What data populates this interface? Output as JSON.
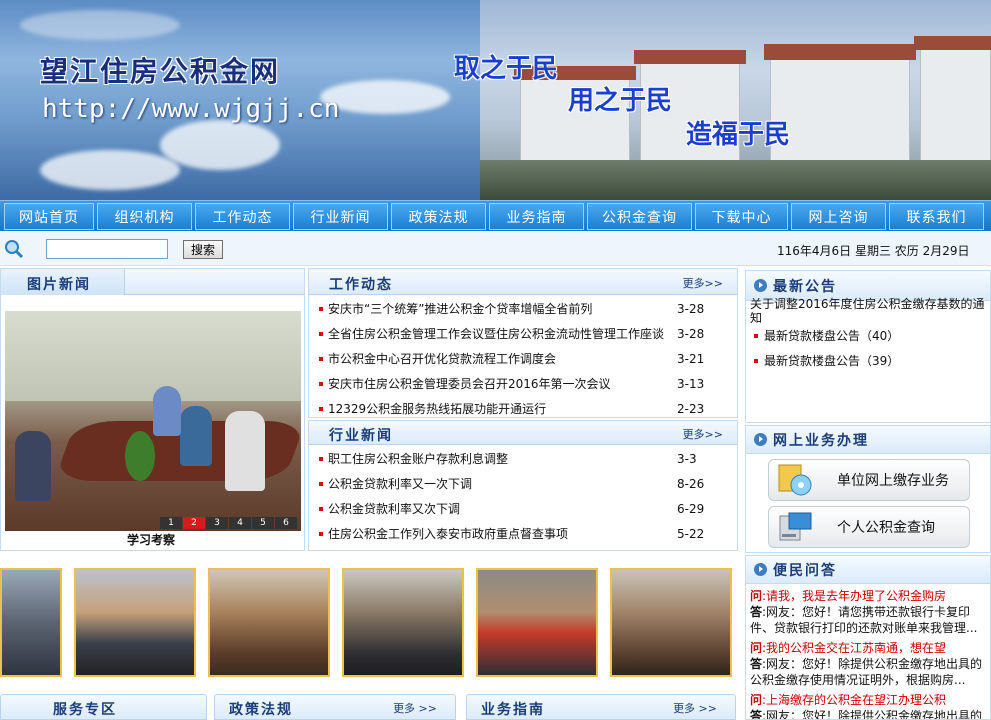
{
  "header": {
    "site_title": "望江住房公积金网",
    "site_url": "http://www.wjgjj.cn",
    "slogans": [
      "取之于民",
      "用之于民",
      "造福于民"
    ]
  },
  "nav": {
    "items": [
      "网站首页",
      "组织机构",
      "工作动态",
      "行业新闻",
      "政策法规",
      "业务指南",
      "公积金查询",
      "下载中心",
      "网上咨询",
      "联系我们"
    ]
  },
  "search": {
    "placeholder": "",
    "button_label": "搜索",
    "date_text": "116年4月6日 星期三 农历 2月29日"
  },
  "photo_news": {
    "tab_label": "图片新闻",
    "pages": [
      "1",
      "2",
      "3",
      "4",
      "5",
      "6"
    ],
    "active_page": "2",
    "caption": "学习考察"
  },
  "work_news": {
    "title": "工作动态",
    "more": "更多>>",
    "items": [
      {
        "title": "安庆市“三个统筹”推进公积金个贷率增幅全省前列",
        "date": "3-28"
      },
      {
        "title": "全省住房公积金管理工作会议暨住房公积金流动性管理工作座谈",
        "date": "3-28"
      },
      {
        "title": "市公积金中心召开优化贷款流程工作调度会",
        "date": "3-21"
      },
      {
        "title": "安庆市住房公积金管理委员会召开2016年第一次会议",
        "date": "3-13"
      },
      {
        "title": "12329公积金服务热线拓展功能开通运行",
        "date": "2-23"
      }
    ]
  },
  "industry_news": {
    "title": "行业新闻",
    "more": "更多>>",
    "items": [
      {
        "title": "职工住房公积金账户存款利息调整",
        "date": "3-3"
      },
      {
        "title": "公积金贷款利率又一次下调",
        "date": "8-26"
      },
      {
        "title": "公积金贷款利率又次下调",
        "date": "6-29"
      },
      {
        "title": "住房公积金工作列入泰安市政府重点督查事项",
        "date": "5-22"
      }
    ]
  },
  "announcements": {
    "title": "最新公告",
    "partial_text": "关于调整2016年度住房公积金缴存基数的通知",
    "items": [
      "最新贷款楼盘公告（40）",
      "最新贷款楼盘公告（39）"
    ]
  },
  "online_business": {
    "title": "网上业务办理",
    "buttons": [
      "单位网上缴存业务",
      "个人公积金查询"
    ]
  },
  "qa": {
    "title": "便民问答",
    "q_prefix": "问",
    "a_prefix": "答",
    "entries": [
      {
        "q": ":请我，我是去年办理了公积金购房",
        "a": ":网友：您好！请您携带还款银行卡复印件、贷款银行打印的还款对账单来我管理..."
      },
      {
        "q": ":我的公积金交在江苏南通，想在望",
        "a": ":网友：您好！除提供公积金缴存地出具的公积金缴存使用情况证明外，根据购房..."
      },
      {
        "q": ":上海缴存的公积金在望江办理公积",
        "a": ":网友：您好！除提供公积金缴存地出具的"
      }
    ]
  },
  "bottom": {
    "service_zone": "服务专区",
    "policy": "政策法规",
    "guide": "业务指南",
    "more": "更多 >>"
  },
  "colors": {
    "nav_blue": "#1b7fd4",
    "title_navy": "#1b3e78",
    "bullet_red": "#d10f0f",
    "qa_red": "#cc0000",
    "thumb_border": "#e9c247"
  }
}
